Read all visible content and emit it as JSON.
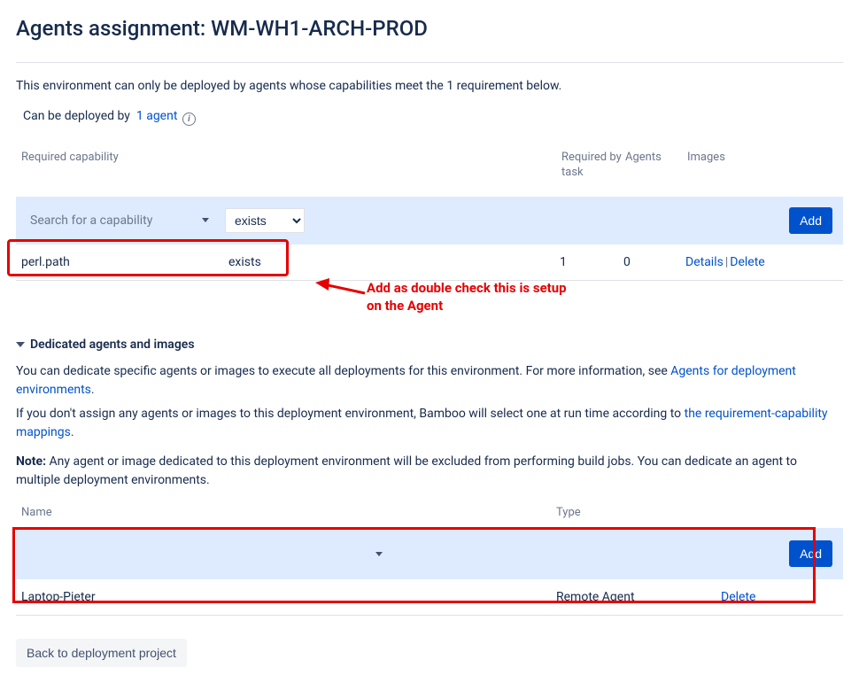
{
  "page": {
    "title_prefix": "Agents assignment: ",
    "title_env": "WM-WH1-ARCH-PROD",
    "intro": "This environment can only be deployed by agents whose capabilities meet the 1 requirement below.",
    "deploy_label": "Can be deployed by",
    "deploy_agent_count_label": "1 agent"
  },
  "capabilities": {
    "headers": {
      "capability": "Required capability",
      "required_by_task": "Required by task",
      "agents": "Agents",
      "images": "Images"
    },
    "search_placeholder": "Search for a capability",
    "condition_selected": "exists",
    "add_button": "Add",
    "rows": [
      {
        "name": "perl.path",
        "condition": "exists",
        "required_by_task": "1",
        "agents": "0",
        "details": "Details",
        "delete": "Delete"
      }
    ]
  },
  "annotation": {
    "text_line1": "Add as double check this is setup",
    "text_line2": "on the Agent"
  },
  "dedicated": {
    "heading": "Dedicated agents and images",
    "para1_before": "You can dedicate specific agents or images to execute all deployments for this environment. For more information, see ",
    "para1_link": "Agents for deployment environments",
    "para1_after": ".",
    "para2_before": "If you don't assign any agents or images to this deployment environment, Bamboo will select one at run time according to ",
    "para2_link": "the requirement-capability mappings",
    "para2_after": ".",
    "note_label": "Note:",
    "note_text": " Any agent or image dedicated to this deployment environment will be excluded from performing build jobs. You can dedicate an agent to multiple deployment environments.",
    "headers": {
      "name": "Name",
      "type": "Type"
    },
    "add_button": "Add",
    "rows": [
      {
        "name": "Laptop-Pieter",
        "type": "Remote Agent",
        "delete": "Delete"
      }
    ]
  },
  "back_button": "Back to deployment project"
}
